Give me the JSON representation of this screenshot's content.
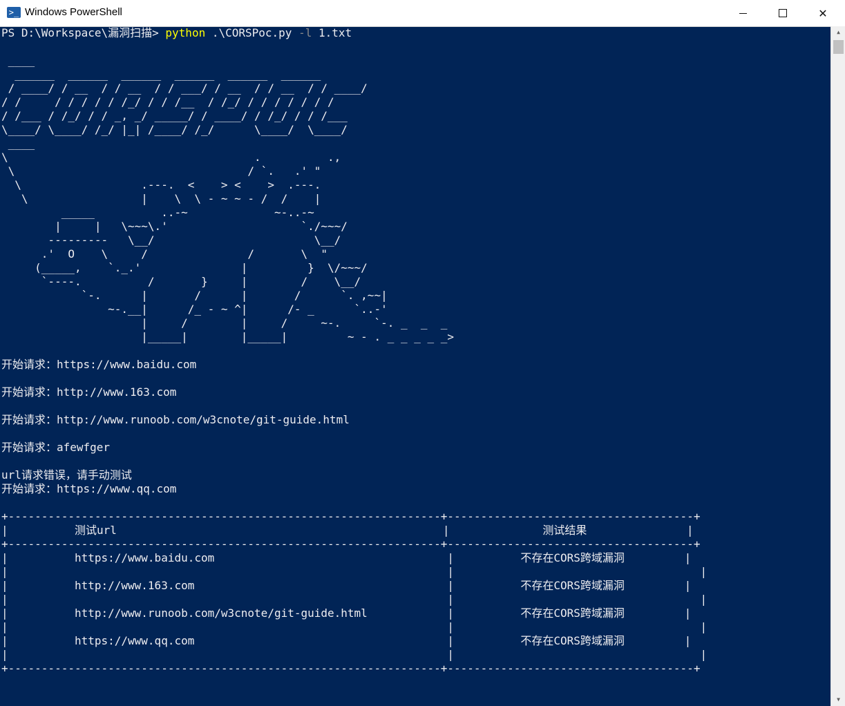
{
  "window": {
    "title": "Windows PowerShell",
    "minimize": "—",
    "maximize": "☐",
    "close": "✕",
    "app_icon": "powershell-icon"
  },
  "prompt": {
    "ps_path": "PS D:\\Workspace\\漏洞扫描> ",
    "command": "python",
    "script": " .\\CORSPoc.py ",
    "flag": "-l",
    "arg": " 1.txt"
  },
  "banner_ascii": " ____\n  ______  ______  ______  ______  ______  ______\n / ____/ / __  / / __  / / ___/ / __  / / __  / / ____/\n/ /     / / / / / /_/ / / /__  / /_/ / / / / / / /\n/ /___ / /_/ / / _, _/ _____/ / ____/ / /_/ / / /___\n\\____/ \\____/ /_/ |_| /____/ /_/      \\____/  \\____/\n ____",
  "dino_ascii": "\\                                     .          .,\n \\                                   / `.   .' \"\n  \\                  .---.  <    > <    >  .---.\n   \\                 |    \\  \\ - ~ ~ - /  /    |\n         _____          ..-~             ~-..-~\n        |     |   \\~~~\\.'                    `./~~~/\n       ---------   \\__/                        \\__/\n      .'  O    \\     /               /       \\  \"\n     (_____,    `._.'               |         }  \\/~~~/\n      `----.          /       }     |        /    \\__/\n            `-.      |       /      |       /      `. ,~~|\n                ~-.__|      /_ - ~ ^|      /- _      `..-'\n                     |     /        |     /     ~-.     `-. _  _  _\n                     |_____|        |_____|         ~ - . _ _ _ _ _>",
  "output_lines": [
    "开始请求：https://www.baidu.com",
    "",
    "开始请求：http://www.163.com",
    "",
    "开始请求：http://www.runoob.com/w3cnote/git-guide.html",
    "",
    "开始请求：afewfger",
    "",
    "url请求错误，请手动测试",
    "开始请求：https://www.qq.com",
    ""
  ],
  "table": {
    "border": "+-----------------------------------------------------------------+-------------------------------------+",
    "header_line": "|          测试url                                                 |              测试结果               |",
    "blank_line": "|                                                                  |                                     |",
    "rows": [
      "|          https://www.baidu.com                                   |          不存在CORS跨域漏洞         |",
      "|          http://www.163.com                                      |          不存在CORS跨域漏洞         |",
      "|          http://www.runoob.com/w3cnote/git-guide.html            |          不存在CORS跨域漏洞         |",
      "|          https://www.qq.com                                      |          不存在CORS跨域漏洞         |"
    ],
    "columns": [
      "测试url",
      "测试结果"
    ]
  },
  "colors": {
    "background": "#012456",
    "text": "#eeedf0",
    "command": "#ffff00",
    "flag": "#8a8a8a"
  }
}
